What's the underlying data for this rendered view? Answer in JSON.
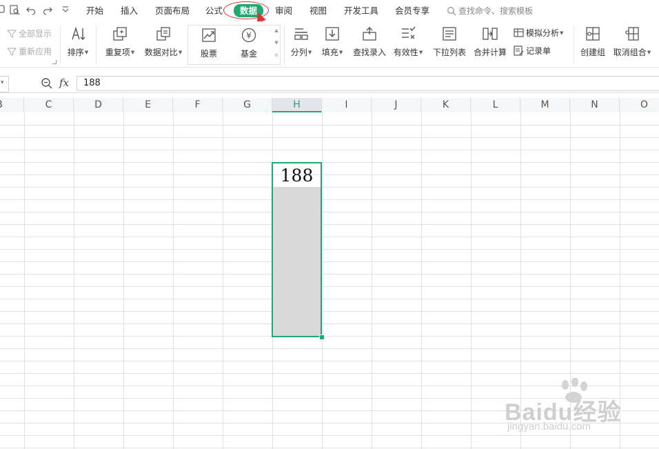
{
  "menu": {
    "tabs": [
      "开始",
      "插入",
      "页面布局",
      "公式",
      "数据",
      "审阅",
      "视图",
      "开发工具",
      "会员专享"
    ],
    "active_tab": "数据",
    "search_placeholder": "查找命令、搜索模板"
  },
  "ribbon": {
    "show_all": "全部显示",
    "reapply": "重新应用",
    "sort": "排序",
    "duplicates": "重复项",
    "data_compare": "数据对比",
    "stock": "股票",
    "fund": "基金",
    "split": "分列",
    "fill": "填充",
    "lookup_entry": "查找录入",
    "validity": "有效性",
    "dropdown_list": "下拉列表",
    "consolidate": "合并计算",
    "what_if": "模拟分析",
    "record_form": "记录单",
    "group": "创建组",
    "ungroup": "取消组合"
  },
  "formula_bar": {
    "fx": "fx",
    "value": "188"
  },
  "columns": [
    "B",
    "C",
    "D",
    "E",
    "F",
    "G",
    "H",
    "I",
    "J",
    "K",
    "L",
    "M",
    "N",
    "O"
  ],
  "selected_column": "H",
  "cell": {
    "value": "188"
  },
  "watermark": {
    "brand": "Baidu经验",
    "url": "jingyan.baidu.com"
  },
  "colors": {
    "accent": "#1fa970",
    "annotation": "#e03030",
    "selection_fill": "#d9d9d9"
  }
}
